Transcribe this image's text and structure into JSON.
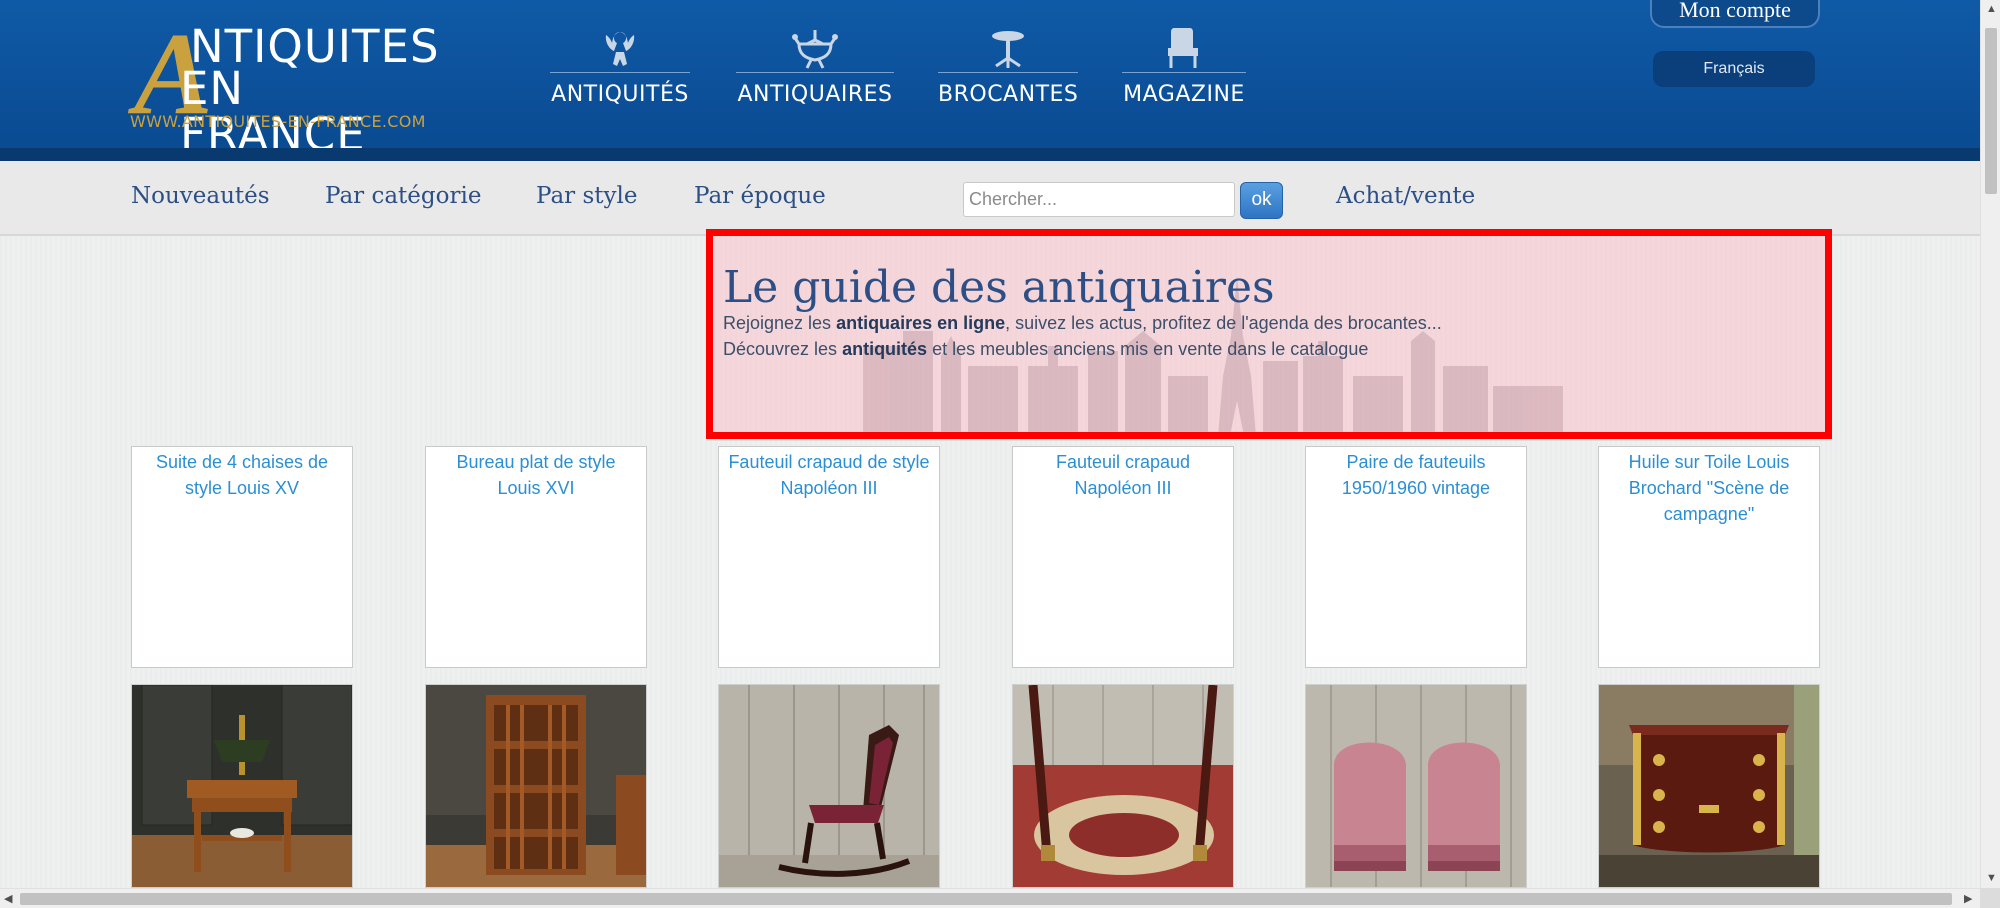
{
  "header": {
    "logo": {
      "letter": "A",
      "line1": "NTIQUITES",
      "line2": "EN FRANCE",
      "url": "WWW.ANTIQUITES-EN-FRANCE.COM"
    },
    "main_nav": [
      {
        "label": "ANTIQUITÉS",
        "icon": "cherub-icon"
      },
      {
        "label": "ANTIQUAIRES",
        "icon": "chandelier-icon"
      },
      {
        "label": "BROCANTES",
        "icon": "pedestal-table-icon"
      },
      {
        "label": "MAGAZINE",
        "icon": "armchair-icon"
      }
    ],
    "account_label": "Mon compte",
    "language_label": "Français"
  },
  "subnav": {
    "links": [
      "Nouveautés",
      "Par catégorie",
      "Par style",
      "Par époque"
    ],
    "search": {
      "placeholder": "Chercher...",
      "value": "",
      "button_label": "ok"
    },
    "trade_link": "Achat/vente"
  },
  "hero": {
    "title": "Le guide des antiquaires",
    "line1": {
      "pre": "Rejoignez les ",
      "bold": "antiquaires en ligne",
      "post": ", suivez les actus, profitez de l'agenda des brocantes..."
    },
    "line2": {
      "pre": "Découvrez les ",
      "bold": "antiquités",
      "post": " et les meubles anciens mis en vente dans le catalogue"
    }
  },
  "listings_row1": [
    {
      "alt": "Suite de 4 chaises de style Louis XV"
    },
    {
      "alt": "Bureau plat de style Louis XVI"
    },
    {
      "alt": "Fauteuil crapaud de style Napoléon III"
    },
    {
      "alt": "Fauteuil crapaud Napoléon III"
    },
    {
      "alt": "Paire de fauteuils 1950/1960 vintage"
    },
    {
      "alt": "Huile sur Toile Louis Brochard \"Scène de campagne\""
    }
  ],
  "listings_row2": [
    {
      "subject": "small-walnut-side-table-with-lamp"
    },
    {
      "subject": "revolving-bookcase"
    },
    {
      "subject": "rocking-chair"
    },
    {
      "subject": "table-legs-on-rug"
    },
    {
      "subject": "pair-of-pink-velvet-armchairs"
    },
    {
      "subject": "marquetry-commode-with-bronzes"
    }
  ],
  "colors": {
    "header_blue": "#0f5aa6",
    "logo_gold": "#c9a23f",
    "link_blue": "#2c4f86",
    "alt_text_blue": "#2b8fd3",
    "highlight_red": "#ff0000"
  }
}
